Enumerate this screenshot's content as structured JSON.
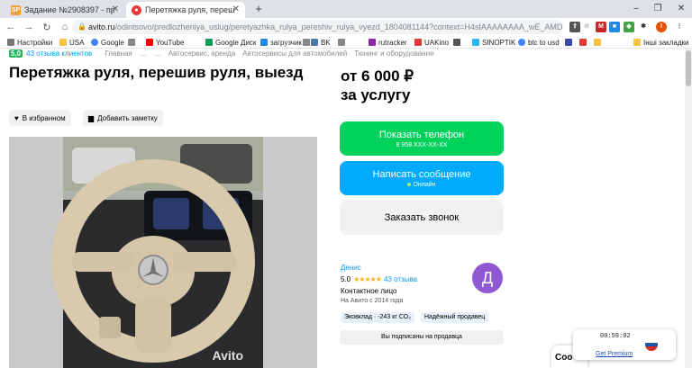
{
  "browser": {
    "tabs": [
      {
        "favicon": "SP",
        "title": "Задание №2908397 - просмотр",
        "active": false,
        "color": "#f0a030"
      },
      {
        "favicon": "avito-icon",
        "title": "Перетяжка руля, перешив руля",
        "active": true,
        "color": "#e53935"
      }
    ],
    "new_tab": "+",
    "url_host": "avito.ru",
    "url_path": "/odintsovo/predlozheniya_uslug/peretyazhka_rulya_pereshiv_rulya_vyezd_1804081144?context=H4sIAAAAAAAA_wE_AMD_YToyO...",
    "bookmarks": [
      {
        "label": "Настройки",
        "icon": "gear-icon"
      },
      {
        "label": "USA",
        "icon": "folder-icon"
      },
      {
        "label": "Google",
        "icon": "google-icon"
      },
      {
        "label": "",
        "icon": "bookmark-icon"
      },
      {
        "label": "YouTube",
        "icon": "youtube-icon"
      },
      {
        "label": "Google Диск",
        "icon": "drive-icon"
      },
      {
        "label": "загрузчик",
        "icon": "download-icon"
      },
      {
        "label": "",
        "icon": "bookmark-icon"
      },
      {
        "label": "BK",
        "icon": "vk-icon"
      },
      {
        "label": "",
        "icon": "bookmark-icon"
      },
      {
        "label": "rutracker",
        "icon": "rutracker-icon"
      },
      {
        "label": "UAKino",
        "icon": "uakino-icon"
      },
      {
        "label": "",
        "icon": "bookmark-icon"
      },
      {
        "label": "SINOPTIK",
        "icon": "sinoptik-icon"
      },
      {
        "label": "btc to usd",
        "icon": "google-icon"
      },
      {
        "label": "",
        "icon": "bookmark-icon"
      },
      {
        "label": "",
        "icon": "bookmark-icon"
      },
      {
        "label": "",
        "icon": "bookmark-icon"
      },
      {
        "label": "Інші закладки",
        "icon": "folder-icon"
      }
    ]
  },
  "breadcrumbs": {
    "rating": "5,0",
    "reviews": "43 отзыва клиентов",
    "items": [
      "Главная",
      "…",
      "…",
      "Автосервис, аренда",
      "Автосервисы для автомобилей",
      "Тюнинг и оборудование"
    ]
  },
  "listing": {
    "title": "Перетяжка руля, перешив руля, выезд",
    "favorite_label": "В избранном",
    "note_label": "Добавить заметку",
    "watermark": "Avito",
    "price_line1": "от 6 000 ₽",
    "price_line2": "за услугу"
  },
  "actions": {
    "phone_label": "Показать телефон",
    "phone_number": "8 958 XXX-XX-XX",
    "message_label": "Написать сообщение",
    "message_status": "Онлайн",
    "call_label": "Заказать звонок",
    "subscribed_label": "Вы подписаны на продавца"
  },
  "seller": {
    "name": "Денис",
    "rating": "5.0",
    "rating_value": 5,
    "reviews": "43 отзыва",
    "type": "Контактное лицо",
    "since": "На Авито с 2014 года",
    "avatar_letter": "Д",
    "avatar_color": "#8f59d1",
    "badges": [
      "Эковклад · -243 кг CO₂",
      "Надёжный продавец"
    ]
  },
  "widgets": {
    "chat_label": "Соо",
    "vpn_timer": "00:59:02",
    "vpn_premium": "Get Premium"
  },
  "colors": {
    "green": "#02d15c",
    "blue": "#00aaff",
    "link": "#0099f7"
  }
}
